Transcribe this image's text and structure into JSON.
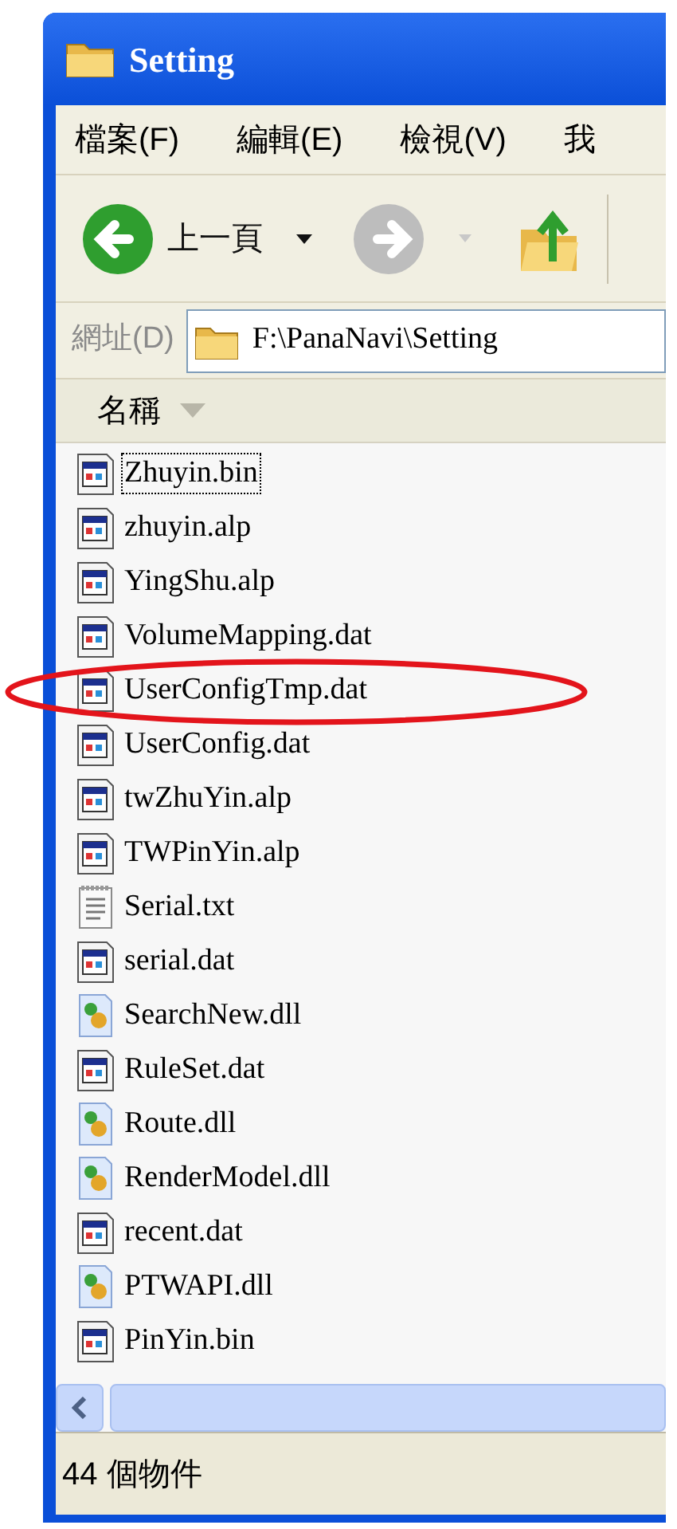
{
  "window": {
    "title": "Setting"
  },
  "menu": [
    "檔案(F)",
    "編輯(E)",
    "檢視(V)",
    "我"
  ],
  "toolbar": {
    "back_label": "上一頁"
  },
  "address": {
    "label": "網址(D)",
    "value": "F:\\PanaNavi\\Setting"
  },
  "columns": [
    "名稱"
  ],
  "files": [
    {
      "name": "Zhuyin.bin",
      "kind": "data",
      "focused": true,
      "circled": false
    },
    {
      "name": "zhuyin.alp",
      "kind": "data",
      "focused": false,
      "circled": false
    },
    {
      "name": "YingShu.alp",
      "kind": "data",
      "focused": false,
      "circled": false
    },
    {
      "name": "VolumeMapping.dat",
      "kind": "data",
      "focused": false,
      "circled": false
    },
    {
      "name": "UserConfigTmp.dat",
      "kind": "data",
      "focused": false,
      "circled": true
    },
    {
      "name": "UserConfig.dat",
      "kind": "data",
      "focused": false,
      "circled": false
    },
    {
      "name": "twZhuYin.alp",
      "kind": "data",
      "focused": false,
      "circled": false
    },
    {
      "name": "TWPinYin.alp",
      "kind": "data",
      "focused": false,
      "circled": false
    },
    {
      "name": "Serial.txt",
      "kind": "text",
      "focused": false,
      "circled": false
    },
    {
      "name": "serial.dat",
      "kind": "data",
      "focused": false,
      "circled": false
    },
    {
      "name": "SearchNew.dll",
      "kind": "library",
      "focused": false,
      "circled": false
    },
    {
      "name": "RuleSet.dat",
      "kind": "data",
      "focused": false,
      "circled": false
    },
    {
      "name": "Route.dll",
      "kind": "library",
      "focused": false,
      "circled": false
    },
    {
      "name": "RenderModel.dll",
      "kind": "library",
      "focused": false,
      "circled": false
    },
    {
      "name": "recent.dat",
      "kind": "data",
      "focused": false,
      "circled": false
    },
    {
      "name": "PTWAPI.dll",
      "kind": "library",
      "focused": false,
      "circled": false
    },
    {
      "name": "PinYin.bin",
      "kind": "data",
      "focused": false,
      "circled": false
    }
  ],
  "status_bar": "44 個物件"
}
